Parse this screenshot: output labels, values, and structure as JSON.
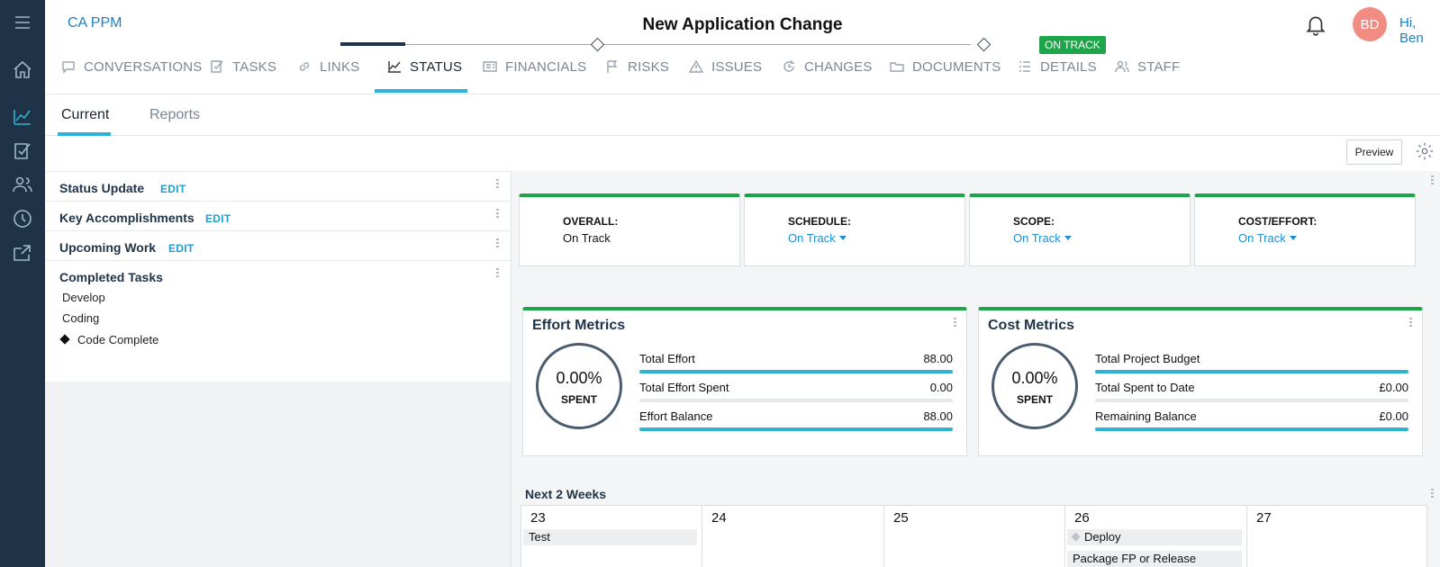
{
  "app": {
    "name": "CA PPM",
    "title": "New Application Change",
    "status_badge": "ON TRACK",
    "user_initials": "BD",
    "greeting": "Hi, Ben"
  },
  "sidebar": {
    "items": [
      {
        "icon": "menu-icon"
      },
      {
        "icon": "home-icon"
      },
      {
        "icon": "chart-icon",
        "active": true
      },
      {
        "icon": "checkbox-icon"
      },
      {
        "icon": "people-icon"
      },
      {
        "icon": "clock-icon"
      },
      {
        "icon": "export-icon"
      }
    ]
  },
  "tabs": [
    {
      "label": "CONVERSATIONS",
      "icon": "comment-icon"
    },
    {
      "label": "TASKS",
      "icon": "checkbox-icon"
    },
    {
      "label": "LINKS",
      "icon": "link-icon"
    },
    {
      "label": "STATUS",
      "icon": "chart-icon",
      "active": true
    },
    {
      "label": "FINANCIALS",
      "icon": "financials-icon"
    },
    {
      "label": "RISKS",
      "icon": "flag-icon"
    },
    {
      "label": "ISSUES",
      "icon": "warning-icon"
    },
    {
      "label": "CHANGES",
      "icon": "changes-icon"
    },
    {
      "label": "DOCUMENTS",
      "icon": "folder-icon"
    },
    {
      "label": "DETAILS",
      "icon": "list-icon"
    },
    {
      "label": "STAFF",
      "icon": "staff-icon"
    }
  ],
  "subtabs": [
    {
      "label": "Current",
      "active": true
    },
    {
      "label": "Reports"
    }
  ],
  "toolbar": {
    "preview_label": "Preview"
  },
  "left": {
    "edit_label": "EDIT",
    "sections": [
      {
        "title": "Status Update"
      },
      {
        "title": "Key Accomplishments"
      },
      {
        "title": "Upcoming Work"
      },
      {
        "title": "Completed Tasks"
      }
    ],
    "completed_tasks": [
      {
        "name": "Develop",
        "milestone": false
      },
      {
        "name": "Coding",
        "milestone": false
      },
      {
        "name": "Code Complete",
        "milestone": true
      }
    ]
  },
  "status_cards": [
    {
      "label": "OVERALL:",
      "value": "On Track",
      "dropdown": false
    },
    {
      "label": "SCHEDULE:",
      "value": "On Track",
      "dropdown": true
    },
    {
      "label": "SCOPE:",
      "value": "On Track",
      "dropdown": true
    },
    {
      "label": "COST/EFFORT:",
      "value": "On Track",
      "dropdown": true
    }
  ],
  "effort": {
    "title": "Effort Metrics",
    "percent": "0.00%",
    "spent_label": "SPENT",
    "lines": [
      {
        "label": "Total Effort",
        "value": "88.00",
        "fill": 1.0
      },
      {
        "label": "Total Effort Spent",
        "value": "0.00",
        "fill": 0.0
      },
      {
        "label": "Effort Balance",
        "value": "88.00",
        "fill": 1.0
      }
    ]
  },
  "cost": {
    "title": "Cost Metrics",
    "percent": "0.00%",
    "spent_label": "SPENT",
    "lines": [
      {
        "label": "Total Project Budget",
        "value": "",
        "fill": 1.0
      },
      {
        "label": "Total Spent to Date",
        "value": "£0.00",
        "fill": 0.0
      },
      {
        "label": "Remaining Balance",
        "value": "£0.00",
        "fill": 1.0
      }
    ]
  },
  "next": {
    "title": "Next 2 Weeks",
    "days": [
      {
        "day": "23",
        "events": [
          {
            "label": "Test",
            "milestone": false
          }
        ]
      },
      {
        "day": "24",
        "events": []
      },
      {
        "day": "25",
        "events": []
      },
      {
        "day": "26",
        "events": [
          {
            "label": "Deploy",
            "milestone": true
          },
          {
            "label": "Package FP or Release",
            "milestone": false
          }
        ]
      },
      {
        "day": "27",
        "events": []
      }
    ]
  },
  "colors": {
    "sidebar_bg": "#1e3347",
    "accent": "#2fb3d4",
    "status_green": "#1ea449",
    "link_blue": "#1e8fd0"
  }
}
